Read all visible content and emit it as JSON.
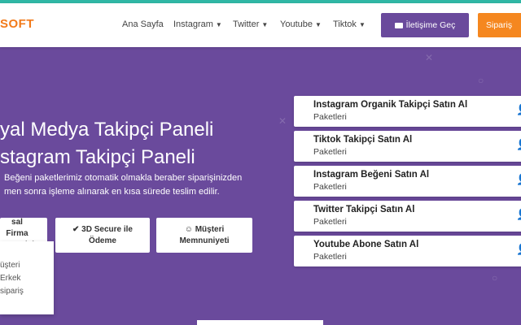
{
  "header": {
    "logo": "SOFT",
    "nav": [
      {
        "label": "Ana Sayfa",
        "dropdown": false
      },
      {
        "label": "Instagram",
        "dropdown": true
      },
      {
        "label": "Twitter",
        "dropdown": true
      },
      {
        "label": "Youtube",
        "dropdown": true
      },
      {
        "label": "Tiktok",
        "dropdown": true
      }
    ],
    "contact_label": "İletişime Geç",
    "order_label": "Sipariş"
  },
  "hero": {
    "title_line1": "yal Medya Takipçi Paneli",
    "title_line2": "stagram Takipçi Paneli",
    "desc_line1": "Beğeni paketlerimiz otomatik olmakla beraber siparişinizden",
    "desc_line2": "men sonra işleme alınarak en kısa sürede teslim edilir.",
    "badges": [
      {
        "line1": "sal Firma",
        "line2": "ntisi"
      },
      {
        "line1": "3D Secure ile",
        "line2": "Ödeme"
      },
      {
        "line1": "Müşteri",
        "line2": "Memnuniyeti"
      }
    ]
  },
  "dropdown": {
    "items": [
      "üşteri",
      "Erkek",
      "sipariş"
    ]
  },
  "packages": [
    {
      "title": "Instagram Organik Takipçi Satın Al",
      "subtitle": "Paketleri"
    },
    {
      "title": "Tiktok Takipçi Satın Al",
      "subtitle": "Paketleri"
    },
    {
      "title": "Instagram Beğeni Satın Al",
      "subtitle": "Paketleri"
    },
    {
      "title": "Twitter Takipçi Satın Al",
      "subtitle": "Paketleri"
    },
    {
      "title": "Youtube Abone Satın Al",
      "subtitle": "Paketleri"
    }
  ],
  "colors": {
    "brand_purple": "#6a4a9c",
    "accent_orange": "#f5871f",
    "top_strip": "#2fb7a5"
  },
  "icons": {
    "contact": "envelope-icon",
    "package": "user-icon",
    "secure": "check-icon",
    "satisfaction": "smile-icon"
  }
}
